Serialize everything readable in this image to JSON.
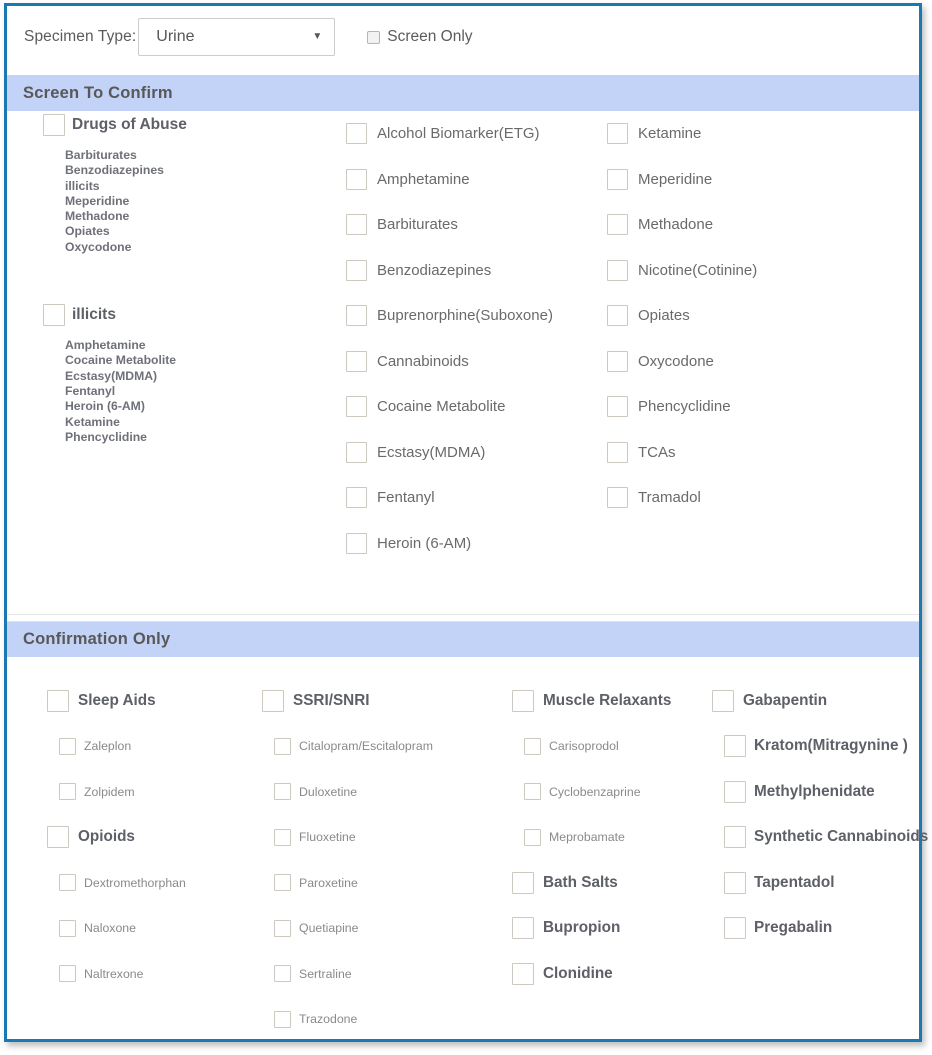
{
  "theme": {
    "frame_border": "#1b78b3",
    "section_header_bg": "#c3d3f7",
    "header_text": "#585858",
    "body_text": "#6a6a6a",
    "bold_text": "#5e6068",
    "sub_text": "#8a8a8a",
    "checkbox_border": "#cdc9c1"
  },
  "toolbar": {
    "specimen_label": "Specimen Type:",
    "specimen_value": "Urine",
    "specimen_caret": "chevron-down-icon",
    "screen_only_label": "Screen Only",
    "screen_only_checked": false
  },
  "screen_to_confirm": {
    "title": "Screen To Confirm",
    "groups": [
      {
        "label": "Drugs of Abuse",
        "checked": false,
        "members": [
          "Barbiturates",
          "Benzodiazepines",
          "illicits",
          "Meperidine",
          "Methadone",
          "Opiates",
          "Oxycodone"
        ]
      },
      {
        "label": "illicits",
        "checked": false,
        "members": [
          "Amphetamine",
          "Cocaine Metabolite",
          "Ecstasy(MDMA)",
          "Fentanyl",
          "Heroin (6-AM)",
          "Ketamine",
          "Phencyclidine"
        ]
      }
    ],
    "column_middle": [
      "Alcohol Biomarker(ETG)",
      "Amphetamine",
      "Barbiturates",
      "Benzodiazepines",
      "Buprenorphine(Suboxone)",
      "Cannabinoids",
      "Cocaine Metabolite",
      "Ecstasy(MDMA)",
      "Fentanyl",
      "Heroin (6-AM)"
    ],
    "column_right": [
      "Ketamine",
      "Meperidine",
      "Methadone",
      "Nicotine(Cotinine)",
      "Opiates",
      "Oxycodone",
      "Phencyclidine",
      "TCAs",
      "Tramadol"
    ]
  },
  "confirmation_only": {
    "title": "Confirmation Only",
    "columns": [
      {
        "items": [
          {
            "label": "Sleep Aids",
            "style": "group"
          },
          {
            "label": "Zaleplon",
            "style": "child"
          },
          {
            "label": "Zolpidem",
            "style": "child"
          },
          {
            "label": "Opioids",
            "style": "group"
          },
          {
            "label": "Dextromethorphan",
            "style": "child"
          },
          {
            "label": "Naloxone",
            "style": "child"
          },
          {
            "label": "Naltrexone",
            "style": "child"
          }
        ]
      },
      {
        "items": [
          {
            "label": "SSRI/SNRI",
            "style": "group"
          },
          {
            "label": "Citalopram/Escitalopram",
            "style": "child"
          },
          {
            "label": "Duloxetine",
            "style": "child"
          },
          {
            "label": "Fluoxetine",
            "style": "child"
          },
          {
            "label": "Paroxetine",
            "style": "child"
          },
          {
            "label": "Quetiapine",
            "style": "child"
          },
          {
            "label": "Sertraline",
            "style": "child"
          },
          {
            "label": "Trazodone",
            "style": "child"
          }
        ]
      },
      {
        "items": [
          {
            "label": "Muscle Relaxants",
            "style": "group"
          },
          {
            "label": "Carisoprodol",
            "style": "child"
          },
          {
            "label": "Cyclobenzaprine",
            "style": "child"
          },
          {
            "label": "Meprobamate",
            "style": "child"
          },
          {
            "label": "Bath Salts",
            "style": "group"
          },
          {
            "label": "Bupropion",
            "style": "group"
          },
          {
            "label": "Clonidine",
            "style": "group"
          }
        ]
      },
      {
        "items": [
          {
            "label": "Gabapentin",
            "style": "group"
          },
          {
            "label": "Kratom(Mitragynine )",
            "style": "group-indented"
          },
          {
            "label": "Methylphenidate",
            "style": "group-indented"
          },
          {
            "label": "Synthetic Cannabinoids",
            "style": "group-indented"
          },
          {
            "label": "Tapentadol",
            "style": "group-indented"
          },
          {
            "label": "Pregabalin",
            "style": "group-indented"
          }
        ]
      }
    ]
  }
}
